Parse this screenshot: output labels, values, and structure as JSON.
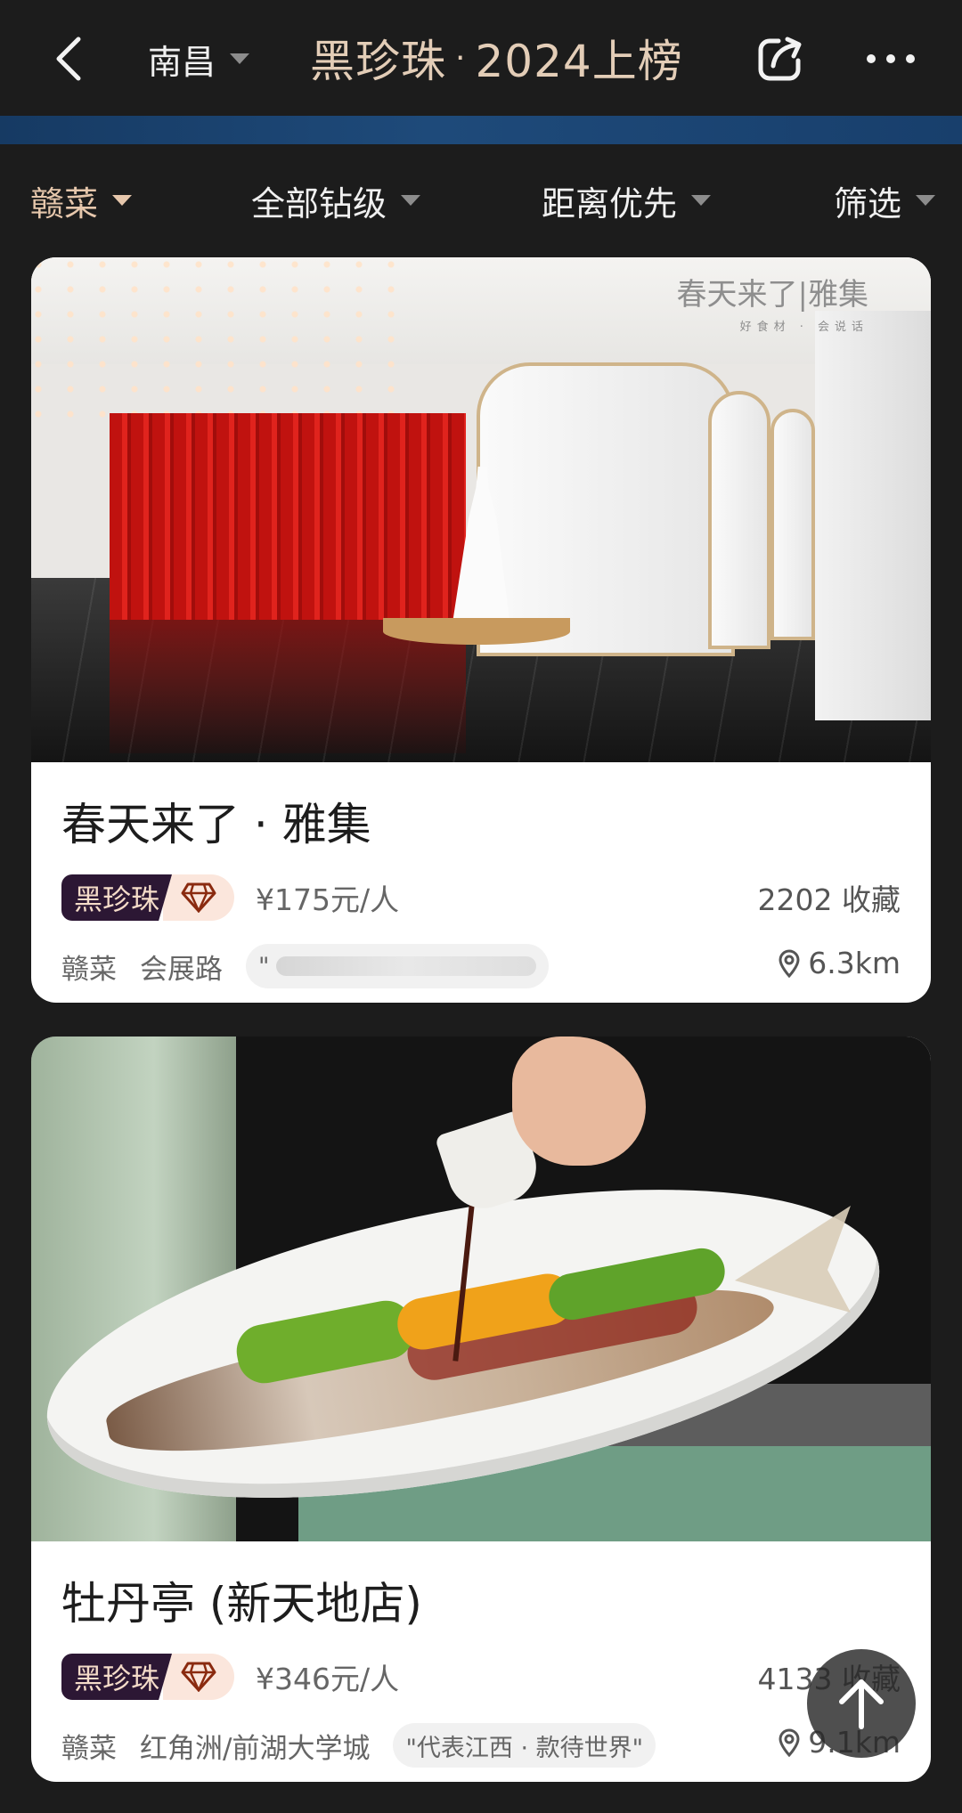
{
  "header": {
    "city": "南昌",
    "brand_name": "黑珍珠",
    "brand_dot": "·",
    "brand_year": "2024上榜"
  },
  "filters": [
    {
      "label": "赣菜",
      "active": true
    },
    {
      "label": "全部钻级",
      "active": false
    },
    {
      "label": "距离优先",
      "active": false
    },
    {
      "label": "筛选",
      "active": false
    }
  ],
  "colors": {
    "accent": "#e6c7ac",
    "badge_dark": "#2c1734",
    "band_blue": "#1e4a7a"
  },
  "restaurants": [
    {
      "photo_sign": "春天来了|雅集",
      "photo_sign_sub": "好食材 · 会说话",
      "name": "春天来了 · 雅集",
      "badge": "黑珍珠",
      "badge_icon": "diamond-icon",
      "price": "¥175元/人",
      "favorites": "2202 收藏",
      "cuisine": "赣菜",
      "area": "会展路",
      "quote": "\"",
      "distance": "6.3km"
    },
    {
      "name": "牡丹亭 (新天地店)",
      "badge": "黑珍珠",
      "badge_icon": "diamond-icon",
      "price": "¥346元/人",
      "favorites": "4133 收藏",
      "cuisine": "赣菜",
      "area": "红角洲/前湖大学城",
      "quote": "\"代表江西 · 款待世界\"",
      "distance": "9.1km"
    }
  ]
}
